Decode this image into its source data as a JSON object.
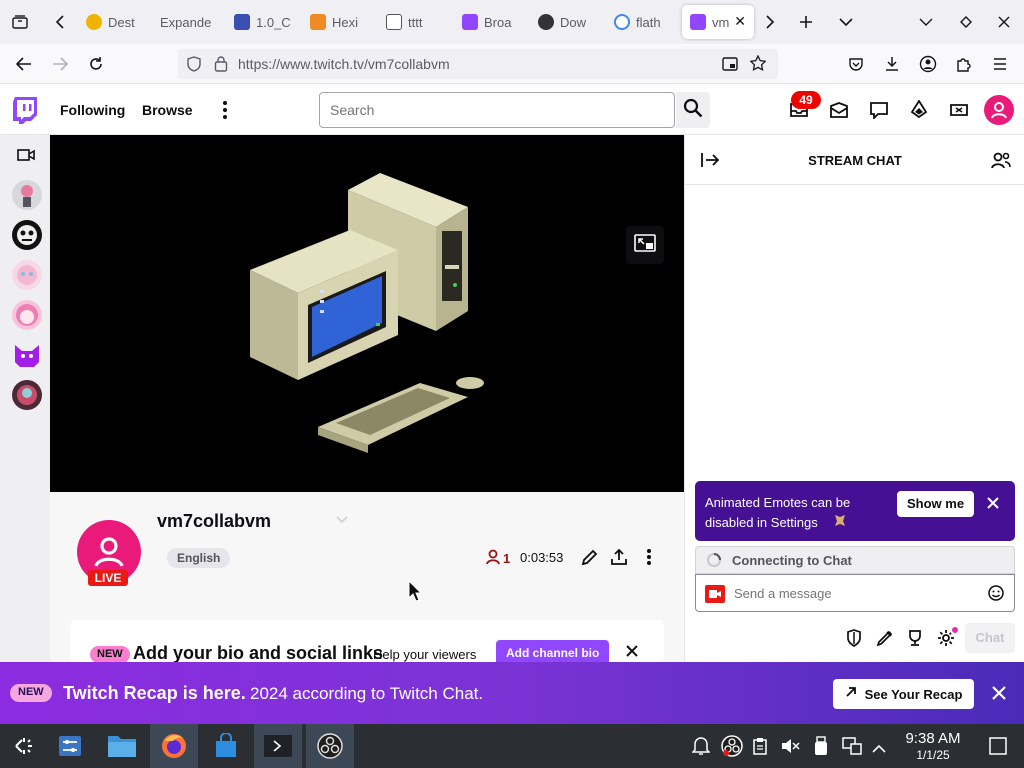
{
  "browser": {
    "tabs": [
      {
        "title": "Dest",
        "favicon_color": "#f0b400"
      },
      {
        "title": "Expande",
        "favicon_color": ""
      },
      {
        "title": "1.0_C",
        "favicon_color": "#3a4fb0"
      },
      {
        "title": "Hexi",
        "favicon_color": "#f08a24"
      },
      {
        "title": "tttt",
        "favicon_color": "#555555"
      },
      {
        "title": "Broa",
        "favicon_color": "#9146ff"
      },
      {
        "title": "Dow",
        "favicon_color": "#333333"
      },
      {
        "title": "flath",
        "favicon_color": "#4285f4"
      },
      {
        "title": "vm",
        "favicon_color": "#9146ff"
      }
    ],
    "url": "https://www.twitch.tv/vm7collabvm"
  },
  "twitch": {
    "nav": {
      "following": "Following",
      "browse": "Browse"
    },
    "search_placeholder": "Search",
    "notifications_count": "49",
    "brand_color": "#9146ff"
  },
  "channel": {
    "name": "vm7collabvm",
    "live_label": "LIVE",
    "language": "English",
    "viewers": "1",
    "uptime": "0:03:53"
  },
  "bio_card": {
    "new_label": "NEW",
    "title": "Add your bio and social links",
    "subtitle": "Help your viewers",
    "button": "Add channel bio"
  },
  "chat": {
    "title": "STREAM CHAT",
    "notice_text": "Animated Emotes can be disabled in Settings",
    "notice_button": "Show me",
    "connecting": "Connecting to Chat",
    "input_placeholder": "Send a message",
    "send_button": "Chat"
  },
  "recap": {
    "new_label": "NEW",
    "title": "Twitch Recap is here.",
    "subtitle": "2024 according to Twitch Chat.",
    "button": "See Your Recap"
  },
  "taskbar": {
    "time": "9:38 AM",
    "date": "1/1/25"
  }
}
